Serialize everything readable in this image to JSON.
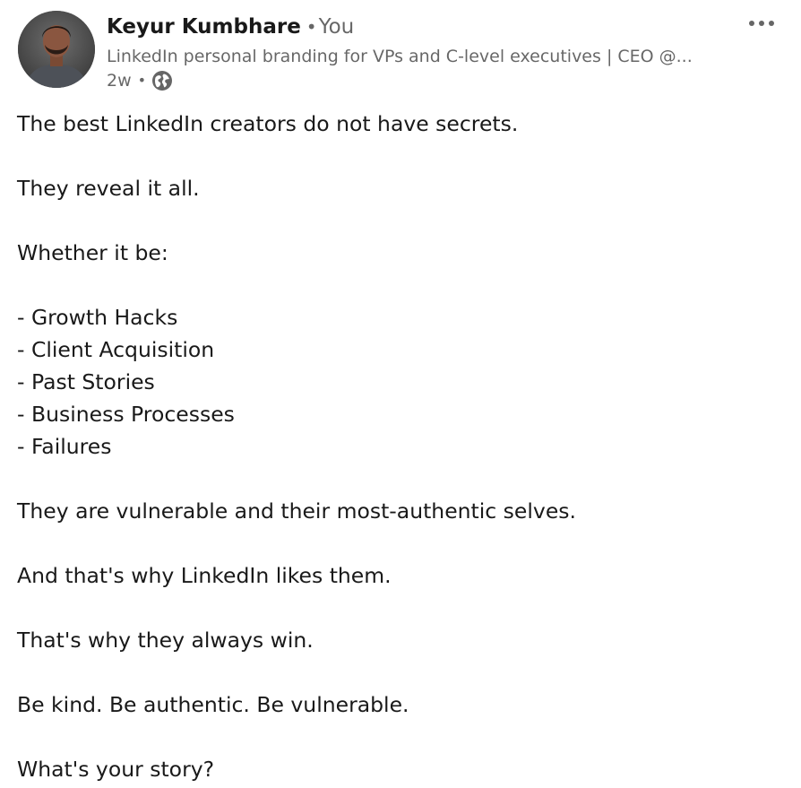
{
  "author": {
    "name": "Keyur Kumbhare",
    "relation": "You",
    "headline": "LinkedIn personal branding for VPs and C-level executives | CEO @...",
    "time": "2w"
  },
  "icons": {
    "avatar": "profile-photo",
    "visibility": "globe-icon",
    "menu": "more-options-icon"
  },
  "post": {
    "lines": [
      "The best LinkedIn creators do not have secrets.",
      "",
      "They reveal it all.",
      "",
      "Whether it be:",
      "",
      "- Growth Hacks",
      "- Client Acquisition",
      "- Past Stories",
      "- Business Processes",
      "- Failures",
      "",
      "They are vulnerable and their most-authentic selves.",
      "",
      "And that's why LinkedIn likes them.",
      "",
      "That's why they always win.",
      "",
      "Be kind. Be authentic. Be vulnerable.",
      "",
      "What's your story?"
    ]
  }
}
